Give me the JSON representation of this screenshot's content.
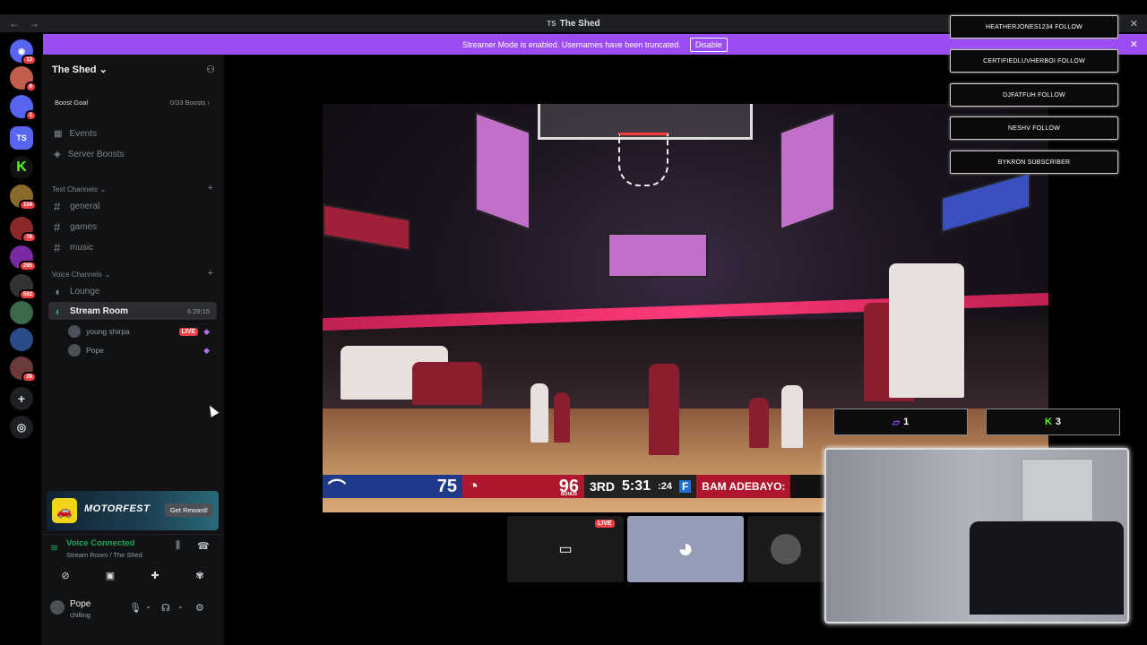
{
  "window": {
    "title": "The Shed",
    "title_prefix": "TS"
  },
  "streamer_bar": {
    "message": "Streamer Mode is enabled. Usernames have been truncated.",
    "disable_label": "Disable"
  },
  "servers": [
    {
      "label": "",
      "badge": "13",
      "color": "#5865f2"
    },
    {
      "label": "",
      "badge": "6",
      "color": "#c0604c"
    },
    {
      "label": "",
      "badge": "1",
      "color": "#5865f2"
    },
    {
      "label": "TS",
      "badge": "",
      "color": "#5865f2"
    },
    {
      "label": "K",
      "badge": "",
      "color": "#111"
    },
    {
      "label": "",
      "badge": "104",
      "color": "#8a6a2a"
    },
    {
      "label": "",
      "badge": "78",
      "color": "#8a2a2a"
    },
    {
      "label": "",
      "badge": "295",
      "color": "#7a2aa0"
    },
    {
      "label": "",
      "badge": "562",
      "color": "#333"
    },
    {
      "label": "",
      "badge": "",
      "color": "#3a6a4a"
    },
    {
      "label": "",
      "badge": "",
      "color": "#2a4a8a"
    },
    {
      "label": "",
      "badge": "28",
      "color": "#6a3a3a"
    }
  ],
  "sidebar": {
    "server_name": "The Shed",
    "boost_goal": {
      "label": "Boost Goal",
      "value": "0/33 Boosts"
    },
    "events": "Events",
    "server_boosts": "Server Boosts",
    "text_category": "Text Channels",
    "text_channels": [
      "general",
      "games",
      "music"
    ],
    "voice_category": "Voice Channels",
    "voice_channels": [
      {
        "name": "Lounge"
      },
      {
        "name": "Stream Room",
        "timer": "6:29:15"
      }
    ],
    "members": [
      {
        "name": "young shirpa",
        "live": "LIVE"
      },
      {
        "name": "Pope"
      }
    ]
  },
  "promo": {
    "title": "MOTORFEST",
    "button": "Get Reward!"
  },
  "voice_panel": {
    "status": "Voice Connected",
    "location": "Stream Room / The Shed"
  },
  "user": {
    "name": "Pope",
    "status": "chilling"
  },
  "scoreboard": {
    "team1_score": "75",
    "team2_score": "96",
    "bonus": "BONUS",
    "quarter": "3RD",
    "clock": "5:31",
    "shot_clock": ":24",
    "ticker": "BAM ADEBAYO:"
  },
  "thumbnails": {
    "live_label": "LIVE"
  },
  "alerts": [
    "HEATHERJONES1234 FOLLOW",
    "CERTIFIEDLUVHERBOI FOLLOW",
    "DJFATFUH FOLLOW",
    "NESHV FOLLOW",
    "BYKRON SUBSCRIBER"
  ],
  "counters": [
    {
      "icon": "twitch-icon",
      "value": "1",
      "color": "#9146ff"
    },
    {
      "icon": "kick-icon",
      "value": "3",
      "color": "#53fc18"
    }
  ]
}
